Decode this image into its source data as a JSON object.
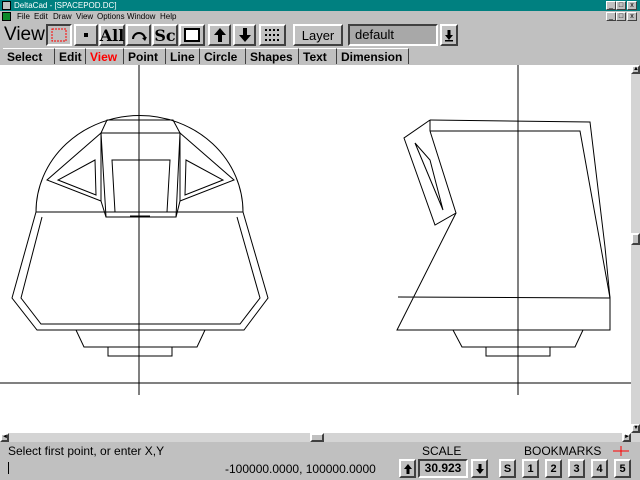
{
  "window": {
    "title": "DeltaCad - [SPACEPOD.DC]",
    "min": "_",
    "max": "□",
    "close": "x"
  },
  "menu": [
    "File",
    "Edit",
    "Draw",
    "View",
    "Options",
    "Window",
    "Help"
  ],
  "toolbar": {
    "mode": "View",
    "all_label": "All",
    "sc_label": "Sc",
    "layer_button": "Layer",
    "layer_value": "default"
  },
  "tabs": [
    {
      "label": "Select",
      "active": false
    },
    {
      "label": "Edit",
      "active": false
    },
    {
      "label": "View",
      "active": true
    },
    {
      "label": "Point",
      "active": false
    },
    {
      "label": "Line",
      "active": false
    },
    {
      "label": "Circle",
      "active": false
    },
    {
      "label": "Shapes",
      "active": false
    },
    {
      "label": "Text",
      "active": false
    },
    {
      "label": "Dimension",
      "active": false
    }
  ],
  "status": {
    "prompt": "Select first point, or enter X,Y",
    "coords": "-100000.0000, 100000.0000",
    "scale_label": "SCALE",
    "scale_value": "30.923",
    "bookmarks_label": "BOOKMARKS",
    "bookmarks": [
      "S",
      "1",
      "2",
      "3",
      "4",
      "5"
    ]
  },
  "colors": {
    "active_tab": "#ff0000",
    "titlebar": "#008080",
    "canvas": "#ffffff"
  }
}
